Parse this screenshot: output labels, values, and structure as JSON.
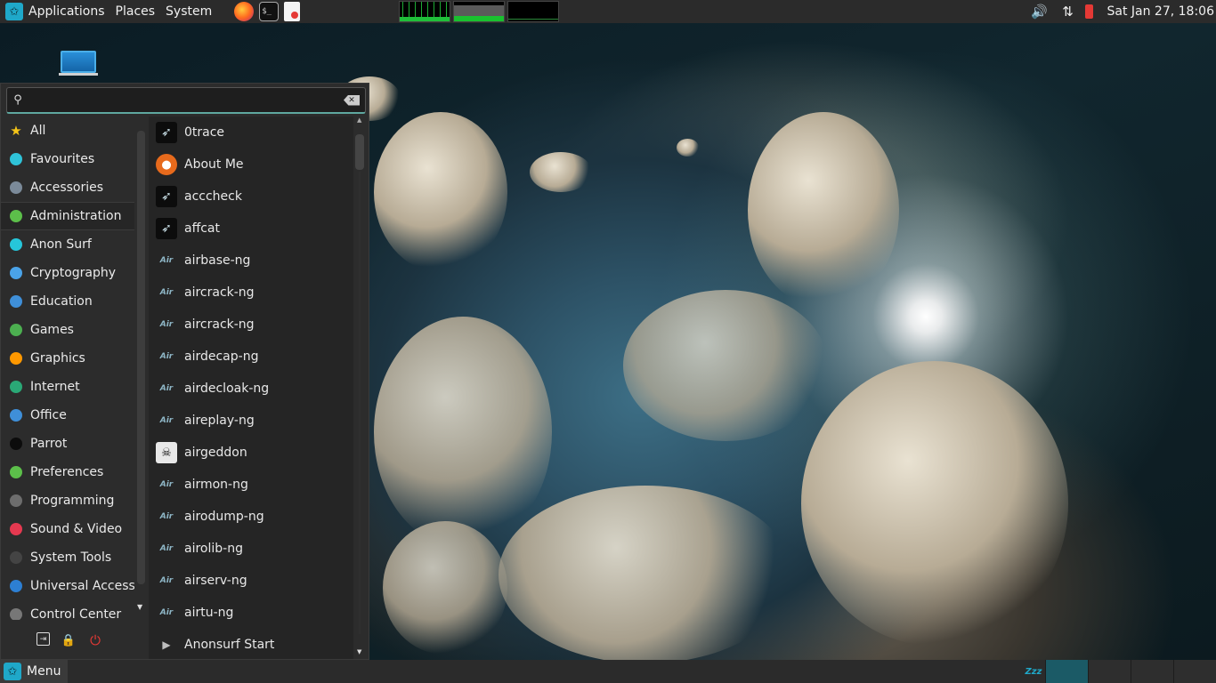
{
  "top_panel": {
    "applications_label": "Applications",
    "places_label": "Places",
    "system_label": "System",
    "launchers": [
      "firefox-icon",
      "terminal-icon",
      "text-editor-icon"
    ],
    "terminal_glyph": "$_",
    "clock": "Sat Jan 27, 18:06",
    "tray": [
      "volume-icon",
      "network-icon",
      "battery-icon"
    ],
    "volume_glyph": "🔊",
    "network_glyph": "⇅"
  },
  "menu": {
    "search": {
      "value": "",
      "placeholder": ""
    },
    "search_glyph": "⚲",
    "clear_glyph": "✕",
    "categories": [
      {
        "label": "All",
        "icon": "star-icon",
        "color": "#f5c518"
      },
      {
        "label": "Favourites",
        "icon": "heart-icon",
        "color": "#2fc3d8"
      },
      {
        "label": "Accessories",
        "icon": "accessories-icon",
        "color": "#7b8a99"
      },
      {
        "label": "Administration",
        "icon": "administration-icon",
        "color": "#5cbf4a"
      },
      {
        "label": "Anon Surf",
        "icon": "anonsurf-icon",
        "color": "#26c6da"
      },
      {
        "label": "Cryptography",
        "icon": "cryptography-icon",
        "color": "#4aa3e8"
      },
      {
        "label": "Education",
        "icon": "education-icon",
        "color": "#3f8fd8"
      },
      {
        "label": "Games",
        "icon": "games-icon",
        "color": "#4caf50"
      },
      {
        "label": "Graphics",
        "icon": "graphics-icon",
        "color": "#ff9800"
      },
      {
        "label": "Internet",
        "icon": "internet-icon",
        "color": "#2aa876"
      },
      {
        "label": "Office",
        "icon": "office-icon",
        "color": "#3f8fd8"
      },
      {
        "label": "Parrot",
        "icon": "parrot-icon",
        "color": "#0c0c0c"
      },
      {
        "label": "Preferences",
        "icon": "preferences-icon",
        "color": "#5cbf4a"
      },
      {
        "label": "Programming",
        "icon": "programming-icon",
        "color": "#6d6d6d"
      },
      {
        "label": "Sound & Video",
        "icon": "sound-video-icon",
        "color": "#e53950"
      },
      {
        "label": "System Tools",
        "icon": "system-tools-icon",
        "color": "#444444"
      },
      {
        "label": "Universal Access",
        "icon": "universal-access-icon",
        "color": "#2d7fd3"
      },
      {
        "label": "Control Center",
        "icon": "control-center-icon",
        "color": "#777777"
      }
    ],
    "hovered_category": "Administration",
    "apps": [
      {
        "label": "0trace",
        "icon": "parrot-icon"
      },
      {
        "label": "About Me",
        "icon": "person-icon"
      },
      {
        "label": "acccheck",
        "icon": "parrot-icon"
      },
      {
        "label": "affcat",
        "icon": "parrot-icon"
      },
      {
        "label": "airbase-ng",
        "icon": "aircrack-icon"
      },
      {
        "label": "aircrack-ng",
        "icon": "aircrack-icon"
      },
      {
        "label": "aircrack-ng",
        "icon": "aircrack-icon"
      },
      {
        "label": "airdecap-ng",
        "icon": "aircrack-icon"
      },
      {
        "label": "airdecloak-ng",
        "icon": "aircrack-icon"
      },
      {
        "label": "aireplay-ng",
        "icon": "aircrack-icon"
      },
      {
        "label": "airgeddon",
        "icon": "skull-icon"
      },
      {
        "label": "airmon-ng",
        "icon": "aircrack-icon"
      },
      {
        "label": "airodump-ng",
        "icon": "aircrack-icon"
      },
      {
        "label": "airolib-ng",
        "icon": "aircrack-icon"
      },
      {
        "label": "airserv-ng",
        "icon": "aircrack-icon"
      },
      {
        "label": "airtu-ng",
        "icon": "aircrack-icon"
      },
      {
        "label": "Anonsurf Start",
        "icon": "play-icon"
      }
    ],
    "aircrack_glyph": "Air",
    "session": [
      "logout-icon",
      "lock-icon",
      "shutdown-icon"
    ],
    "logout_glyph": "⇥",
    "lock_glyph": "🔒",
    "shutdown_glyph": "⏻"
  },
  "bottom_panel": {
    "menu_label": "Menu",
    "sleep_glyph": "Zzz",
    "workspace_count": 4,
    "active_workspace": 1
  },
  "colors": {
    "accent": "#1fa8c9",
    "panel": "#2b2b2b",
    "menu_bg": "#2c2c2c"
  }
}
